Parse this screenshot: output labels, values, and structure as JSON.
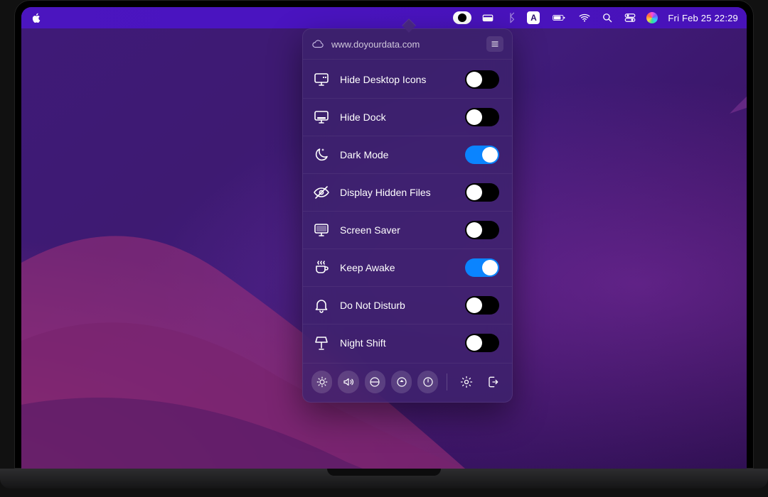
{
  "menubar": {
    "clock": "Fri Feb 25  22:29",
    "input_letter": "A"
  },
  "panel": {
    "header_url": "www.doyourdata.com",
    "items": [
      {
        "label": "Hide Desktop Icons",
        "on": false
      },
      {
        "label": "Hide Dock",
        "on": false
      },
      {
        "label": "Dark Mode",
        "on": true
      },
      {
        "label": "Display Hidden Files",
        "on": false
      },
      {
        "label": "Screen Saver",
        "on": false
      },
      {
        "label": "Keep Awake",
        "on": true
      },
      {
        "label": "Do Not Disturb",
        "on": false
      },
      {
        "label": "Night Shift",
        "on": false
      }
    ]
  }
}
